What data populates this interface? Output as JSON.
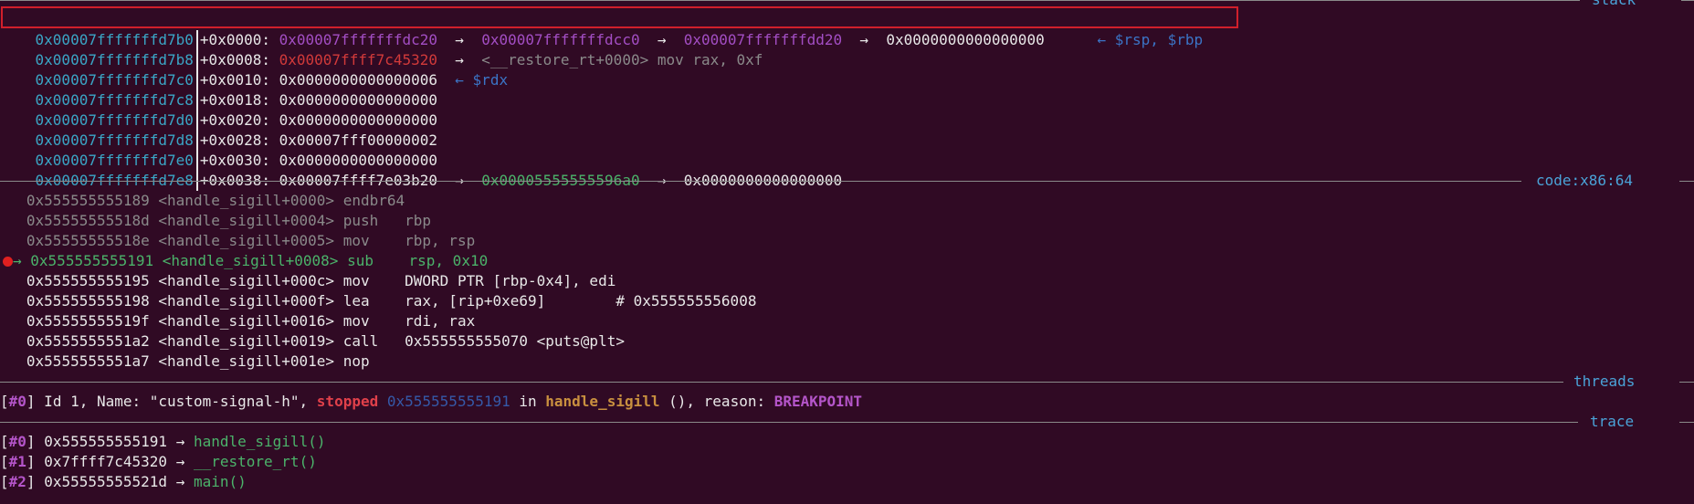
{
  "stack": {
    "title": "stack",
    "rows": [
      {
        "addr": "0x00007fffffffd7b0",
        "off": "+0x0000:",
        "v1": "0x00007fffffffdc20",
        "a1": "→",
        "v2": "0x00007fffffffdcc0",
        "a2": "→",
        "v3": "0x00007fffffffdd20",
        "a3": "→",
        "v4": "0x0000000000000000",
        "note": "← $rsp, $rbp"
      },
      {
        "addr": "0x00007fffffffd7b8",
        "off": "+0x0008:",
        "v1": "0x00007ffff7c45320",
        "a1": "→",
        "sym": "<__restore_rt+0000> mov rax, 0xf"
      },
      {
        "addr": "0x00007fffffffd7c0",
        "off": "+0x0010:",
        "v1": "0x0000000000000006",
        "note": "← $rdx"
      },
      {
        "addr": "0x00007fffffffd7c8",
        "off": "+0x0018:",
        "v1": "0x0000000000000000"
      },
      {
        "addr": "0x00007fffffffd7d0",
        "off": "+0x0020:",
        "v1": "0x0000000000000000"
      },
      {
        "addr": "0x00007fffffffd7d8",
        "off": "+0x0028:",
        "v1": "0x00007fff00000002"
      },
      {
        "addr": "0x00007fffffffd7e0",
        "off": "+0x0030:",
        "v1": "0x0000000000000000"
      },
      {
        "addr": "0x00007fffffffd7e8",
        "off": "+0x0038:",
        "v1": "0x00007ffff7e03b20",
        "a1": "→",
        "v2": "0x00005555555596a0",
        "a2": "→",
        "v3": "0x0000000000000000"
      }
    ]
  },
  "code": {
    "title": "code:x86:64",
    "lines": [
      {
        "addr": "0x555555555189",
        "sym": "<handle_sigill+0000>",
        "mn": "endbr64",
        "ops": ""
      },
      {
        "addr": "0x55555555518d",
        "sym": "<handle_sigill+0004>",
        "mn": "push",
        "ops": "rbp"
      },
      {
        "addr": "0x55555555518e",
        "sym": "<handle_sigill+0005>",
        "mn": "mov",
        "ops": "rbp, rsp"
      },
      {
        "addr": "0x555555555191",
        "sym": "<handle_sigill+0008>",
        "mn": "sub",
        "ops": "rsp, 0x10",
        "marker": "→"
      },
      {
        "addr": "0x555555555195",
        "sym": "<handle_sigill+000c>",
        "mn": "mov",
        "ops": "DWORD PTR [rbp-0x4], edi"
      },
      {
        "addr": "0x555555555198",
        "sym": "<handle_sigill+000f>",
        "mn": "lea",
        "ops": "rax, [rip+0xe69]        # 0x555555556008"
      },
      {
        "addr": "0x55555555519f",
        "sym": "<handle_sigill+0016>",
        "mn": "mov",
        "ops": "rdi, rax"
      },
      {
        "addr": "0x5555555551a2",
        "sym": "<handle_sigill+0019>",
        "mn": "call",
        "ops": "0x555555555070 <puts@plt>"
      },
      {
        "addr": "0x5555555551a7",
        "sym": "<handle_sigill+001e>",
        "mn": "nop",
        "ops": ""
      }
    ]
  },
  "threads": {
    "title": "threads",
    "line": {
      "idx": "#0",
      "text1": " Id 1, Name: \"custom-signal-h\", ",
      "state": "stopped",
      "addr": "0x555555555191",
      "in": " in ",
      "func": "handle_sigill",
      "text2": " (), reason: ",
      "reason": "BREAKPOINT"
    }
  },
  "trace": {
    "title": "trace",
    "frames": [
      {
        "idx": "#0",
        "addr": "0x555555555191",
        "arrow": "→",
        "func": "handle_sigill()"
      },
      {
        "idx": "#1",
        "addr": "0x7ffff7c45320",
        "arrow": "→",
        "func": "__restore_rt()"
      },
      {
        "idx": "#2",
        "addr": "0x55555555521d",
        "arrow": "→",
        "func": "main()"
      }
    ]
  },
  "colors": {
    "background": "#300a24",
    "address": "#3aa6c6",
    "heap_ptr": "#a34ec4",
    "code_ptr": "#d23a3a",
    "current": "#4bb36a",
    "highlight_border": "#d01f2b"
  }
}
